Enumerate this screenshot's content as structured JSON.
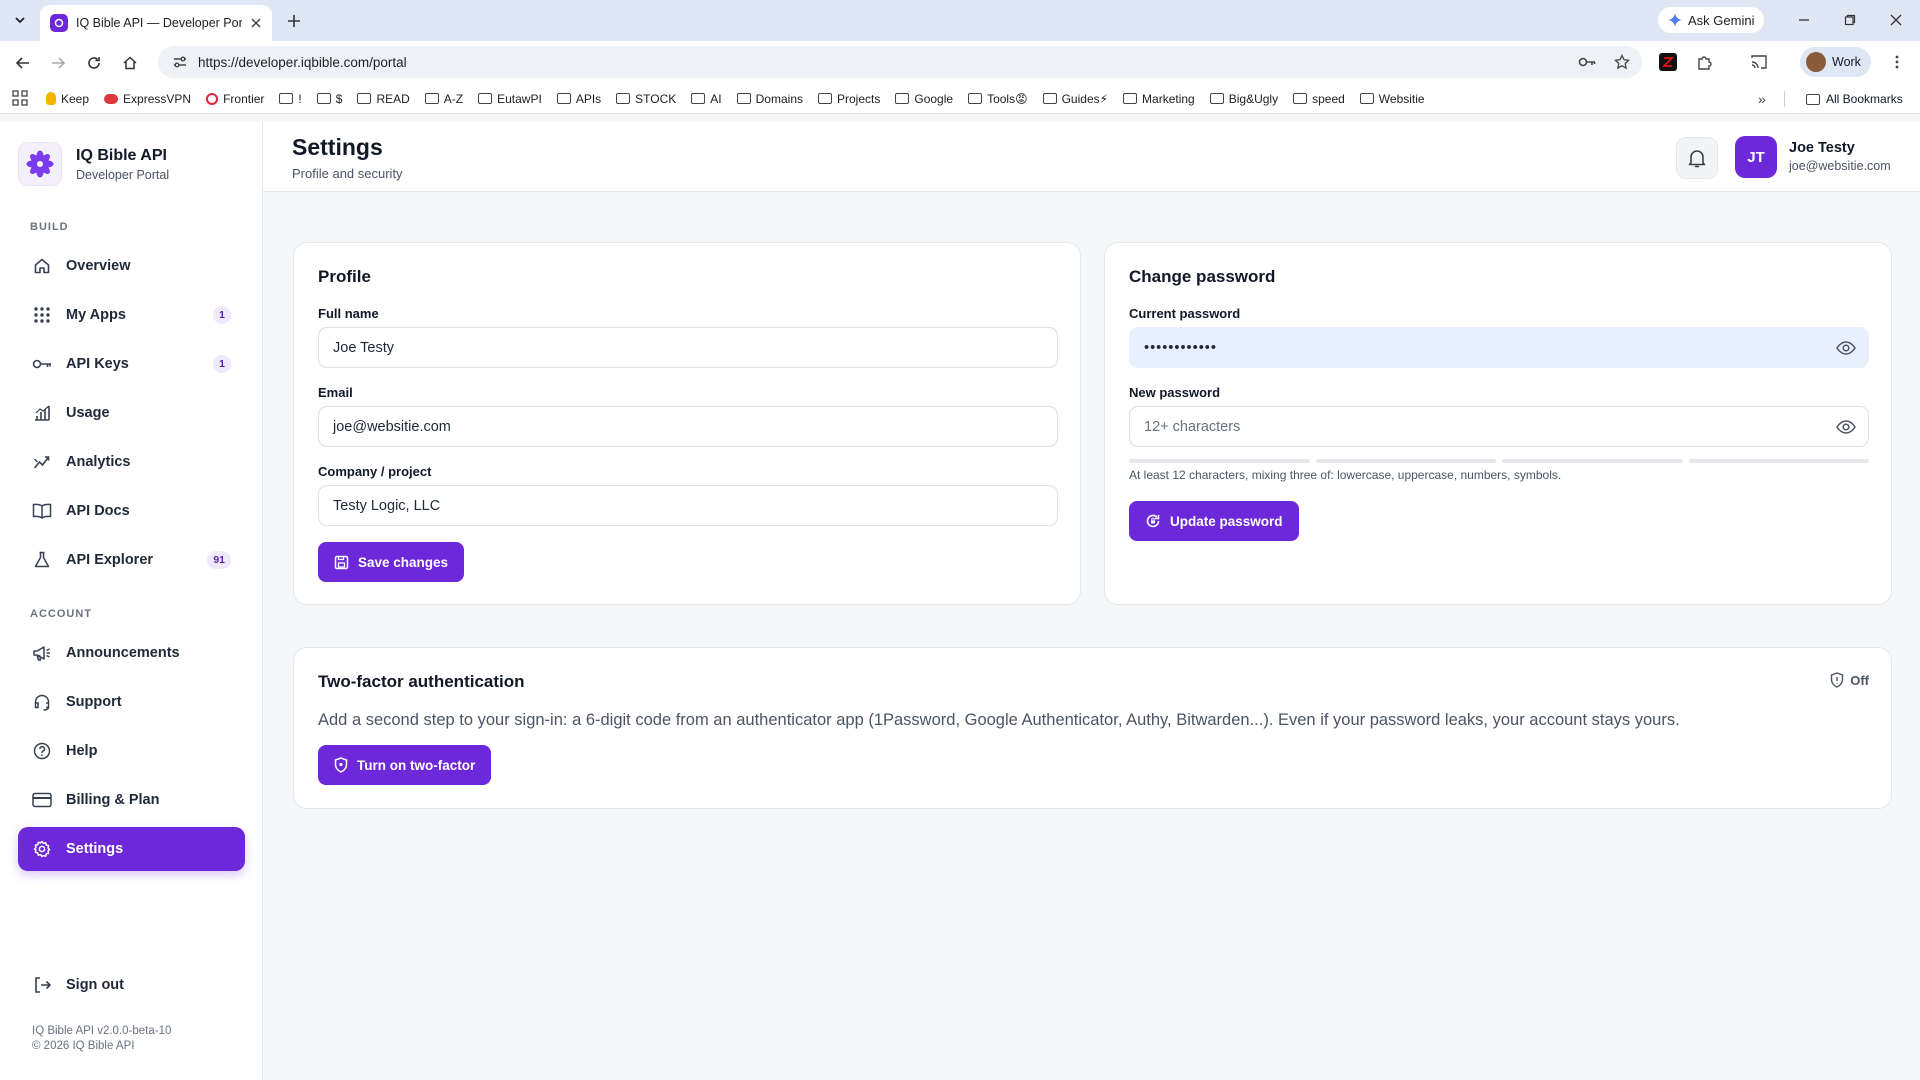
{
  "browser": {
    "tab_title": "IQ Bible API — Developer Porta",
    "url": "https://developer.iqbible.com/portal",
    "gemini_label": "Ask Gemini",
    "profile_label": "Work",
    "bookmarks": [
      "Keep",
      "ExpressVPN",
      "Frontier",
      "!",
      "$",
      "READ",
      "A-Z",
      "EutawPI",
      "APIs",
      "STOCK",
      "AI",
      "Domains",
      "Projects",
      "Google",
      "Tools😡",
      "Guides⚡",
      "Marketing",
      "Big&Ugly",
      "speed",
      "Websitie"
    ],
    "all_bookmarks_label": "All Bookmarks",
    "more_label": "»"
  },
  "sidebar": {
    "brand_name": "IQ Bible API",
    "brand_sub": "Developer Portal",
    "section_build": "BUILD",
    "section_account": "ACCOUNT",
    "build_items": [
      {
        "label": "Overview",
        "icon": "home-icon",
        "badge": ""
      },
      {
        "label": "My Apps",
        "icon": "grid-icon",
        "badge": "1"
      },
      {
        "label": "API Keys",
        "icon": "key-icon",
        "badge": "1"
      },
      {
        "label": "Usage",
        "icon": "bar-chart-icon",
        "badge": ""
      },
      {
        "label": "Analytics",
        "icon": "trend-icon",
        "badge": ""
      },
      {
        "label": "API Docs",
        "icon": "book-icon",
        "badge": ""
      },
      {
        "label": "API Explorer",
        "icon": "flask-icon",
        "badge": "91"
      }
    ],
    "account_items": [
      {
        "label": "Announcements",
        "icon": "megaphone-icon"
      },
      {
        "label": "Support",
        "icon": "headset-icon"
      },
      {
        "label": "Help",
        "icon": "help-circle-icon"
      },
      {
        "label": "Billing & Plan",
        "icon": "credit-card-icon"
      },
      {
        "label": "Settings",
        "icon": "gear-icon",
        "active": true
      }
    ],
    "sign_out": "Sign out",
    "version": "IQ Bible API v2.0.0-beta-10",
    "copyright": "© 2026 IQ Bible API"
  },
  "header": {
    "title": "Settings",
    "subtitle": "Profile and security",
    "user_initials": "JT",
    "user_name": "Joe Testy",
    "user_email": "joe@websitie.com"
  },
  "profile": {
    "title": "Profile",
    "full_name_label": "Full name",
    "full_name_value": "Joe Testy",
    "email_label": "Email",
    "email_value": "joe@websitie.com",
    "company_label": "Company / project",
    "company_value": "Testy Logic, LLC",
    "save_label": "Save changes"
  },
  "password": {
    "title": "Change password",
    "current_label": "Current password",
    "current_value": "••••••••••••",
    "new_label": "New password",
    "new_placeholder": "12+ characters",
    "hint": "At least 12 characters, mixing three of: lowercase, uppercase, numbers, symbols.",
    "strength_filled_segments": 0,
    "update_label": "Update password"
  },
  "two_factor": {
    "title": "Two-factor authentication",
    "status": "Off",
    "description": "Add a second step to your sign-in: a 6-digit code from an authenticator app (1Password, Google Authenticator, Authy, Bitwarden...). Even if your password leaks, your account stays yours.",
    "button_label": "Turn on two-factor"
  },
  "colors": {
    "accent": "#6d28d9",
    "accent_soft": "#efe9fb",
    "autofill_bg": "#e8f0fe"
  }
}
